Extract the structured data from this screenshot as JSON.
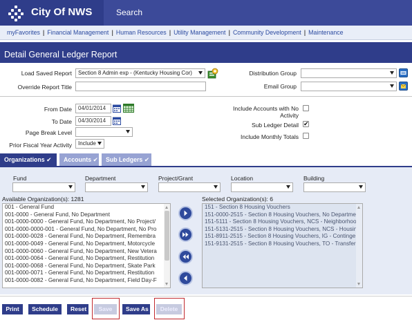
{
  "app": {
    "title": "City Of NWS",
    "search_label": "Search"
  },
  "nav": [
    "myFavorites",
    "Financial Management",
    "Human Resources",
    "Utility Management",
    "Community Development",
    "Maintenance"
  ],
  "page_title": "Detail General Ledger Report",
  "form": {
    "load_saved_report_label": "Load Saved Report",
    "load_saved_report_value": "Section 8 Admin exp - (Kentucky Housing Cor)",
    "override_title_label": "Override Report Title",
    "override_title_value": "",
    "distribution_group_label": "Distribution Group",
    "distribution_group_value": "",
    "email_group_label": "Email Group",
    "email_group_value": "",
    "from_date_label": "From Date",
    "from_date_value": "04/01/2014",
    "to_date_label": "To Date",
    "to_date_value": "04/30/2014",
    "page_break_label": "Page Break Level",
    "page_break_value": "",
    "prior_fy_label": "Prior Fiscal Year Activity",
    "prior_fy_value": "Include",
    "include_no_activity_label_1": "Include Accounts with No",
    "include_no_activity_label_2": "Activity",
    "include_no_activity_checked": false,
    "sub_ledger_label": "Sub Ledger Detail",
    "sub_ledger_checked": true,
    "monthly_totals_label": "Include Monthly Totals",
    "monthly_totals_checked": false
  },
  "tabs": [
    {
      "label": "Organizations ✔",
      "active": true
    },
    {
      "label": "Accounts ✔",
      "active": false
    },
    {
      "label": "Sub Ledgers ✔",
      "active": false
    }
  ],
  "filters": {
    "fund_label": "Fund",
    "department_label": "Department",
    "project_label": "Project/Grant",
    "location_label": "Location",
    "building_label": "Building",
    "available_label": "Available Organization(s): 1281",
    "selected_label": "Selected Organization(s): 6",
    "available": [
      "001 - General Fund",
      "001-0000 - General Fund, No Department",
      "001-0000-0000 - General Fund, No Department, No Project/",
      "001-0000-0000-001 - General Fund, No Department, No Pro",
      "001-0000-0028 - General Fund, No Department, Remembra",
      "001-0000-0049 - General Fund, No Department, Motorcycle",
      "001-0000-0060 - General Fund, No Department, New Vetera",
      "001-0000-0064 - General Fund, No Department, Restitution",
      "001-0000-0068 - General Fund, No Department, Skate Park",
      "001-0000-0071 - General Fund, No Department, Restitution",
      "001-0000-0082 - General Fund, No Department, Field Day-F"
    ],
    "selected": [
      "151 - Section 8 Housing Vouchers",
      "151-0000-2515 - Section 8 Housing Vouchers, No Departme",
      "151-5111 - Section 8 Housing Vouchers, NCS - Neighborhoo",
      "151-5131-2515 - Section 8 Housing Vouchers, NCS - Housin",
      "151-8911-2515 - Section 8 Housing Vouchers, IG - Continge",
      "151-9131-2515 - Section 8 Housing Vouchers, TO - Transfer"
    ]
  },
  "buttons": {
    "print": "Print",
    "schedule": "Schedule",
    "reset": "Reset",
    "save": "Save",
    "save_as": "Save As",
    "delete": "Delete"
  },
  "colors": {
    "header": "#2f3d8a",
    "nav_link": "#2b4aa0",
    "tab_inactive": "#97a3d3",
    "filter_bg": "#e6ebf6",
    "highlight": "#c0282d"
  }
}
